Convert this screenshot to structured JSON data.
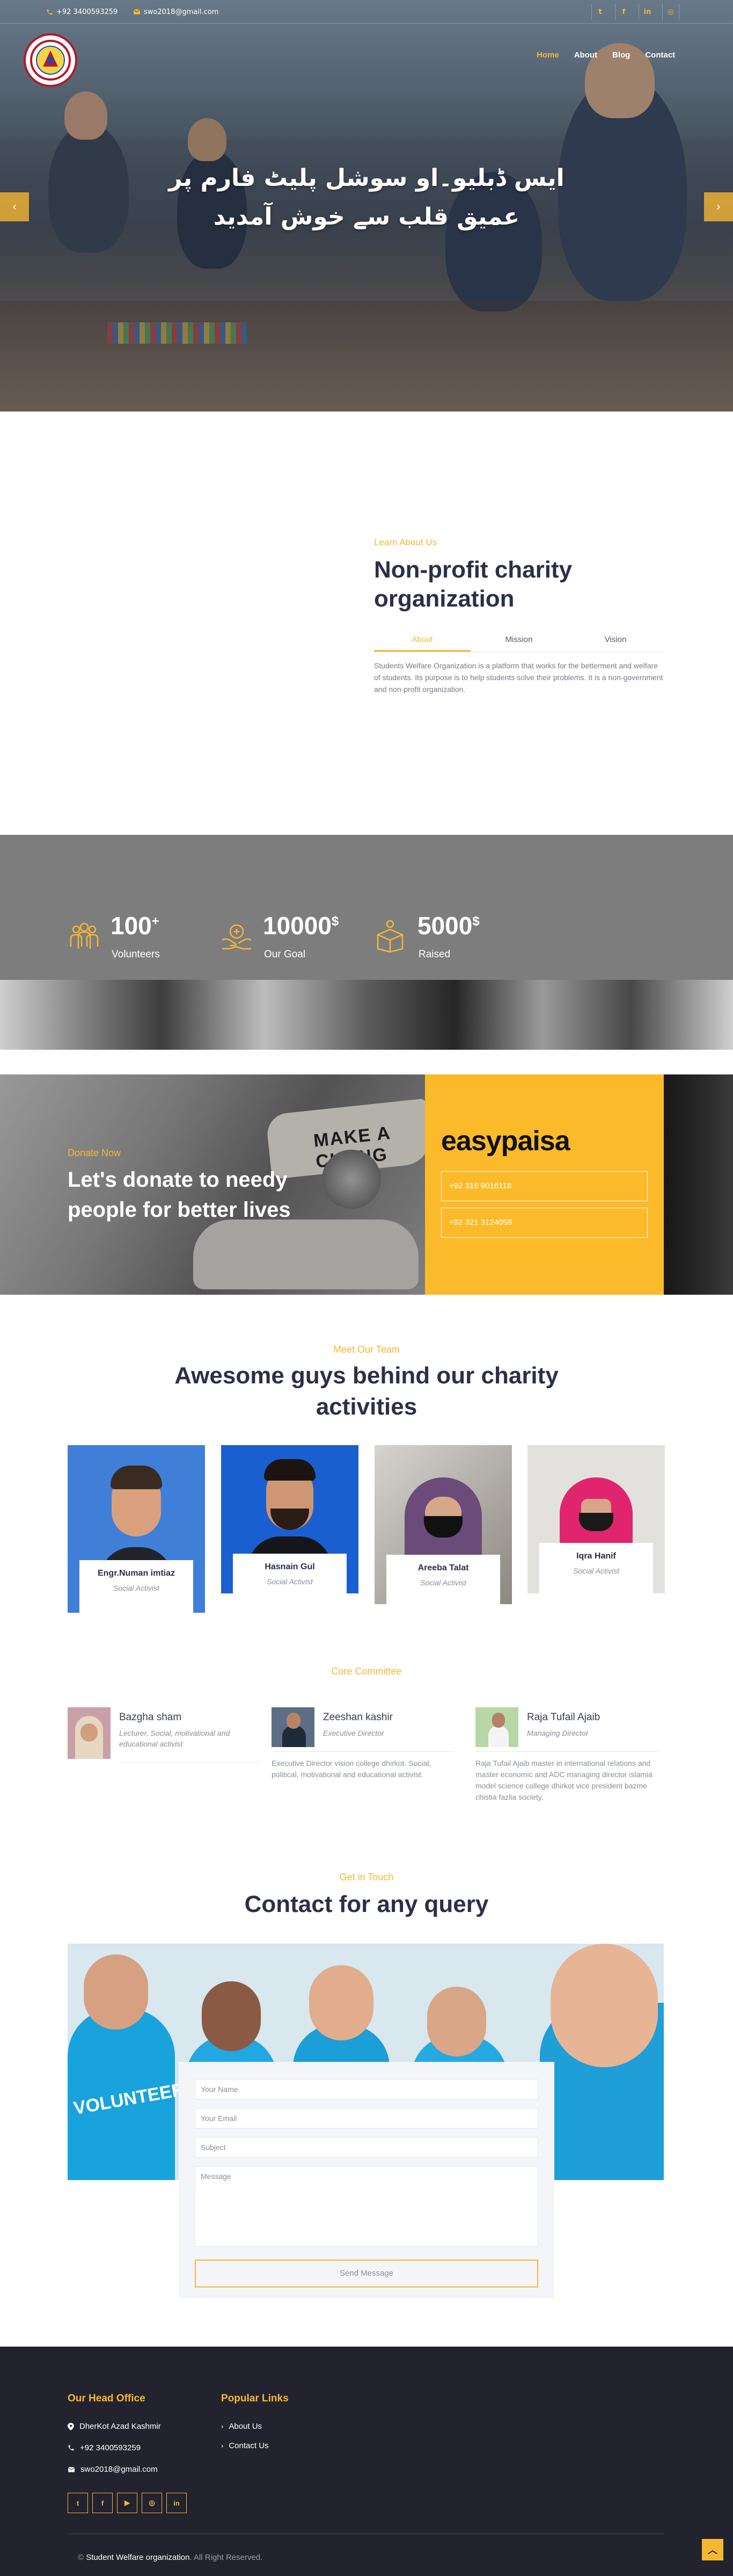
{
  "topbar": {
    "phone": "+92 3400593259",
    "email": "swo2018@gmail.com",
    "social_icons": [
      "twitter-icon",
      "facebook-icon",
      "linkedin-icon",
      "instagram-icon"
    ]
  },
  "nav": {
    "items": [
      {
        "label": "Home",
        "active": true
      },
      {
        "label": "About"
      },
      {
        "label": "Blog"
      },
      {
        "label": "Contact"
      }
    ]
  },
  "hero": {
    "title_line1": "ایس ڈبلیو۔او سوشل پلیٹ فارم پر",
    "title_line2": "عمیق قلب سے خوش آمدید"
  },
  "about": {
    "kicker": "Learn About Us",
    "heading": "Non-profit charity organization",
    "tabs": [
      {
        "label": "About",
        "active": true
      },
      {
        "label": "Mission"
      },
      {
        "label": "Vision"
      }
    ],
    "body": "Students Welfare Organization is a platform that works for the betterment and welfare of students. Its purpose is to help students solve their problems. It is a non-government and non-profit organization."
  },
  "stats": [
    {
      "value": "100",
      "suffix": "+",
      "label": "Volunteers",
      "icon": "volunteers-icon"
    },
    {
      "value": "10000",
      "suffix": "$",
      "label": "Our Goal",
      "icon": "goal-icon"
    },
    {
      "value": "5000",
      "suffix": "$",
      "label": "Raised",
      "icon": "donation-box-icon"
    }
  ],
  "donate": {
    "kicker": "Donate Now",
    "heading": "Let's donate to needy people for better lives",
    "photo_text": "MAKE A CHANG",
    "brand": "easypaisa",
    "phones": [
      "+92 316 9016118",
      "+92 321 3124058"
    ]
  },
  "team": {
    "kicker": "Meet Our Team",
    "heading": "Awesome guys behind our charity activities",
    "members": [
      {
        "name": "Engr.Numan imtiaz",
        "role": "Social Activist"
      },
      {
        "name": "Hasnain Gul",
        "role": "Social Activist"
      },
      {
        "name": "Areeba Talat",
        "role": "Social Activist"
      },
      {
        "name": "Iqra Hanif",
        "role": "Social Activist"
      }
    ]
  },
  "core": {
    "kicker": "Core Committee",
    "members": [
      {
        "name": "Bazgha sham",
        "role": "Lecturer, Social, motivational and educational activist",
        "desc": ""
      },
      {
        "name": "Zeeshan kashir",
        "role": "Executive Director",
        "desc": "Executive Director vision college dhirkot. Social, political, motivational and educational activist."
      },
      {
        "name": "Raja Tufail Ajaib",
        "role": "Managing Director",
        "desc": "Raja Tufail Ajaib master in international relations and master economic and ADC managing director islamia model science college dhirkot vice president bazme chistia fazlia society."
      }
    ]
  },
  "contact": {
    "kicker": "Get in Touch",
    "heading": "Contact for any query",
    "photo_text": "VOLUNTEER",
    "placeholders": {
      "name": "Your Name",
      "email": "Your Email",
      "subject": "Subject",
      "message": "Message"
    },
    "send_label": "Send Message"
  },
  "footer": {
    "office_heading": "Our Head Office",
    "address": "DherKot Azad Kashmir",
    "phone": "+92 3400593259",
    "email": "swo2018@gmail.com",
    "links_heading": "Popular Links",
    "links": [
      "About Us",
      "Contact Us"
    ],
    "social_icons": [
      "twitter-icon",
      "facebook-icon",
      "youtube-icon",
      "instagram-icon",
      "linkedin-icon"
    ],
    "copyright_prefix": "©",
    "org_name": "Student Welfare organization",
    "rights": ". All Right Reserved."
  },
  "colors": {
    "accent": "#f7b733",
    "heading": "#2c2f4a",
    "footer_bg": "#22232e",
    "easypaisa_bg": "#fbba29"
  }
}
